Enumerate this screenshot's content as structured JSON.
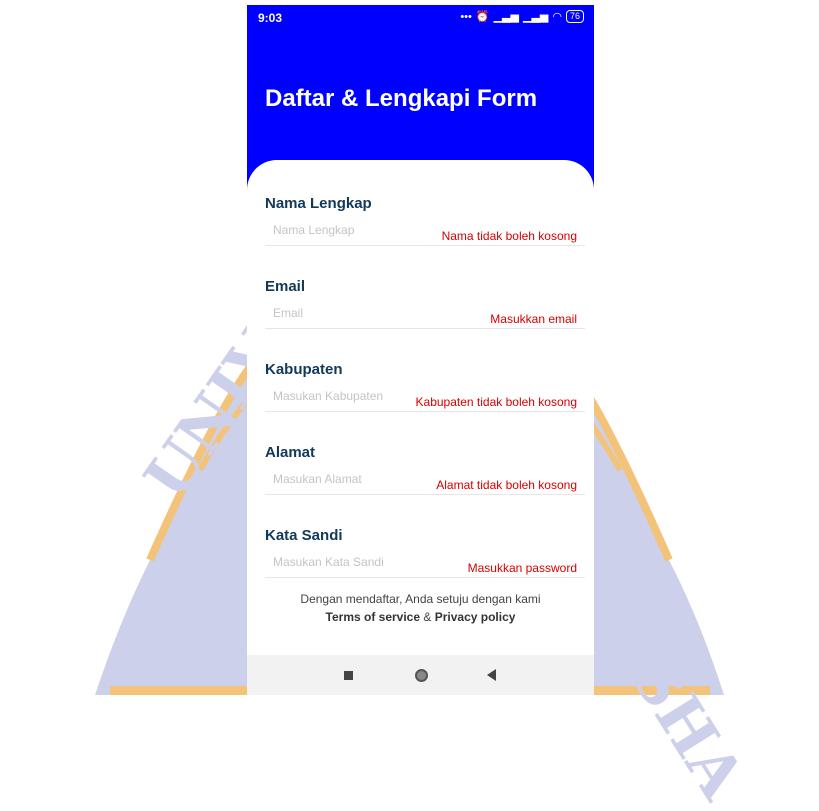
{
  "status_bar": {
    "time": "9:03",
    "icons": [
      "dots-icon",
      "alarm-icon",
      "signal-icon",
      "signal-icon",
      "wifi-icon"
    ],
    "battery": "76"
  },
  "header": {
    "title": "Daftar & Lengkapi Form"
  },
  "form": {
    "fields": [
      {
        "label": "Nama Lengkap",
        "placeholder": "Nama Lengkap",
        "value": "",
        "error": "Nama tidak boleh kosong"
      },
      {
        "label": "Email",
        "placeholder": "Email",
        "value": "",
        "error": "Masukkan email"
      },
      {
        "label": "Kabupaten",
        "placeholder": "Masukan Kabupaten",
        "value": "",
        "error": "Kabupaten tidak boleh kosong"
      },
      {
        "label": "Alamat",
        "placeholder": "Masukan Alamat",
        "value": "",
        "error": "Alamat tidak boleh kosong"
      },
      {
        "label": "Kata Sandi",
        "placeholder": "Masukan Kata Sandi",
        "value": "",
        "error": "Masukkan password"
      }
    ]
  },
  "footer": {
    "consent": "Dengan mendaftar, Anda setuju dengan kami",
    "terms_link": "Terms of service",
    "ampersand": "&",
    "privacy_link": "Privacy policy"
  },
  "watermark": {
    "left_text": "UNIVERSI",
    "right_text": "GANESHA",
    "color": "#cdd0ea",
    "accent": "#f3c37a"
  },
  "colors": {
    "header_bg": "#0000ff",
    "label": "#12385a",
    "error": "#d80000"
  }
}
